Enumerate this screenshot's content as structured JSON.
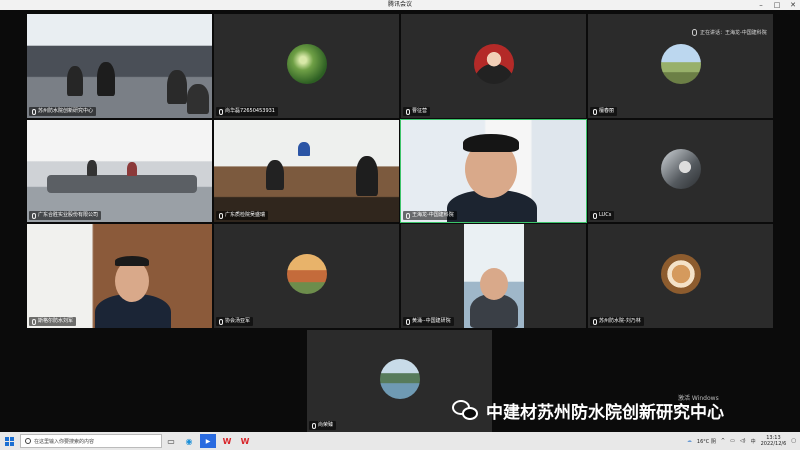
{
  "window": {
    "title": "腾讯会议"
  },
  "speaker": {
    "label": "正在讲话：王海龙-中国建科院"
  },
  "tiles": [
    {
      "name": "苏州防水院创新研究中心"
    },
    {
      "name": "尚华磊72650453931"
    },
    {
      "name": "曹征营"
    },
    {
      "name": "檀春丽"
    },
    {
      "name": "广东合胜实业股份有限公司"
    },
    {
      "name": "广东质检院吴盛瑞"
    },
    {
      "name": "王海龙-中国建科院"
    },
    {
      "name": "LUCs"
    },
    {
      "name": "斯格尔防水刘军"
    },
    {
      "name": "协会汤亚军"
    },
    {
      "name": "黄涌--中国建研院"
    },
    {
      "name": "苏州防水院-刘乃林"
    },
    {
      "name": "尚荣臻"
    }
  ],
  "watermark": {
    "text": "中建材苏州防水院创新研究中心"
  },
  "activate": {
    "text": "激活 Windows"
  },
  "taskbar": {
    "search_placeholder": "在这里输入你要搜索的内容",
    "weather": "16°C 阴",
    "ime": "中",
    "time": "13:13",
    "date": "2022/12/6"
  }
}
